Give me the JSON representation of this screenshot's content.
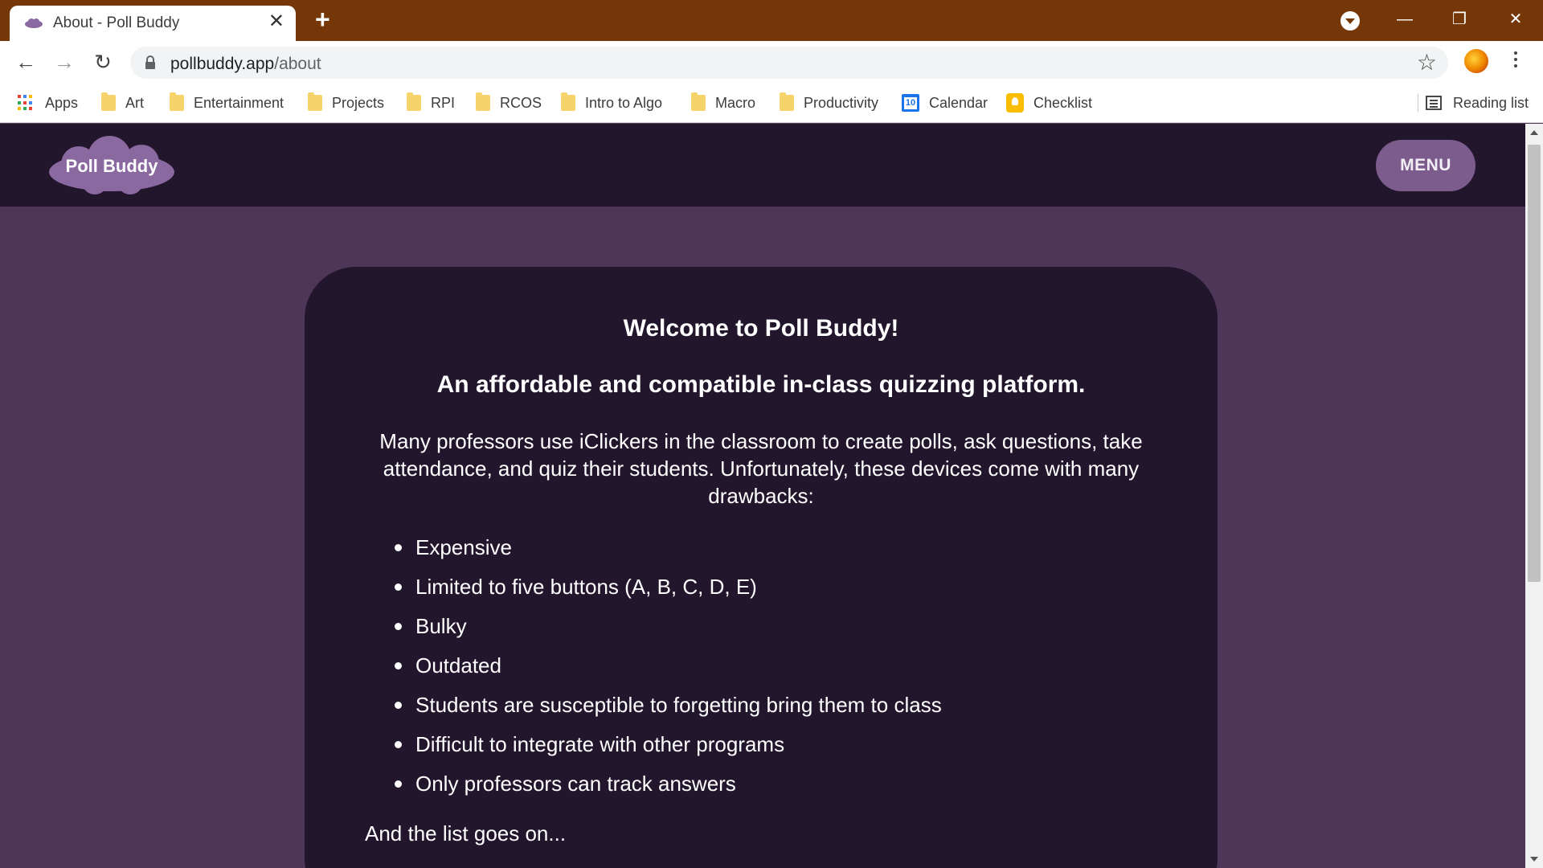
{
  "browser": {
    "tab_title": "About - Poll Buddy",
    "tab_close": "✕",
    "new_tab": "+",
    "url_domain": "pollbuddy.app",
    "url_path": "/about",
    "star": "☆",
    "window_controls": {
      "minimize": "—",
      "restore": "❐",
      "close": "✕"
    },
    "nav": {
      "back": "←",
      "forward": "→",
      "reload": "↻"
    }
  },
  "bookmarks": [
    {
      "label": "Apps",
      "icon": "apps-grid-icon"
    },
    {
      "label": "Art",
      "icon": "folder-icon"
    },
    {
      "label": "Entertainment",
      "icon": "folder-icon"
    },
    {
      "label": "Projects",
      "icon": "folder-icon"
    },
    {
      "label": "RPI",
      "icon": "folder-icon"
    },
    {
      "label": "RCOS",
      "icon": "folder-icon"
    },
    {
      "label": "Intro to Algo",
      "icon": "folder-icon"
    },
    {
      "label": "Macro",
      "icon": "folder-icon"
    },
    {
      "label": "Productivity",
      "icon": "folder-icon"
    },
    {
      "label": "Calendar",
      "icon": "calendar-icon",
      "badge": "10"
    },
    {
      "label": "Checklist",
      "icon": "keep-icon"
    }
  ],
  "reading_list": "Reading list",
  "site": {
    "logo_text": "Poll Buddy",
    "menu_label": "MENU",
    "heading": "Welcome to Poll Buddy!",
    "subheading": "An affordable and compatible in-class quizzing platform.",
    "intro": "Many professors use iClickers in the classroom to create polls, ask questions, take attendance, and quiz their students. Unfortunately, these devices come with many drawbacks:",
    "drawbacks": [
      "Expensive",
      "Limited to five buttons (A, B, C, D, E)",
      "Bulky",
      "Outdated",
      "Students are susceptible to forgetting bring them to class",
      "Difficult to integrate with other programs",
      "Only professors can track answers"
    ],
    "outro": "And the list goes on..."
  },
  "colors": {
    "chrome_frame": "#763708",
    "page_bg": "#4e3659",
    "header_bg": "#22162d",
    "card_bg": "#22162d",
    "accent": "#7c5b8d"
  }
}
